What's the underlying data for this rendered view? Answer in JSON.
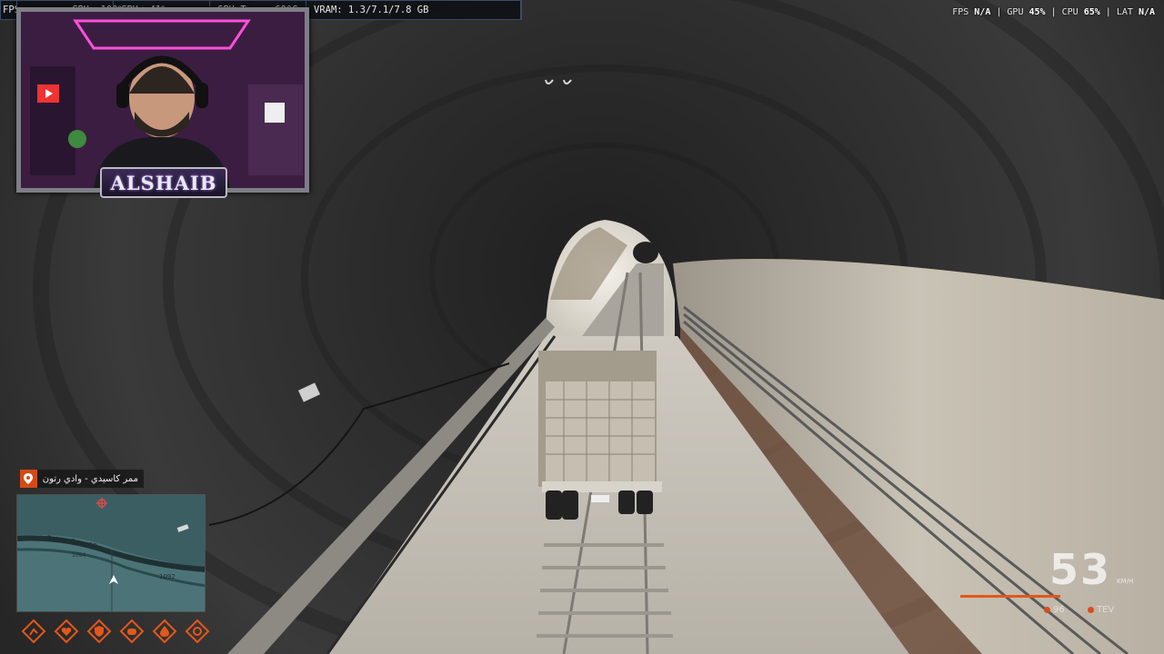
{
  "stats": {
    "cells": [
      "FPS",
      "CPU: 100%",
      "GPU: 41%",
      "GPU Temp: 60°C",
      "VRAM: 1.3/7.1/7.8 GB"
    ]
  },
  "perf": {
    "fps_label": "FPS",
    "fps_value": "N/A",
    "gpu_label": "GPU",
    "gpu_value": "45%",
    "cpu_label": "CPU",
    "cpu_value": "65%",
    "lat_label": "LAT",
    "lat_value": "N/A"
  },
  "webcam": {
    "logo_text": "ALSHAIB"
  },
  "location": {
    "text": "ممر كاسيدي - وادي رتون"
  },
  "minimap": {
    "road_label": "Raton Canyon",
    "elev_1": "1092",
    "elev_2": "1094"
  },
  "status_icons": [
    "stamina-icon",
    "health-icon",
    "armor-icon",
    "hunger-icon",
    "thirst-icon",
    "stress-icon"
  ],
  "hud": {
    "speed": "53",
    "speed_unit": "KM/H",
    "stat_left": "96",
    "stat_right": "TEV"
  },
  "colors": {
    "accent": "#e4571a",
    "tunnel": "#2b2b2b"
  }
}
